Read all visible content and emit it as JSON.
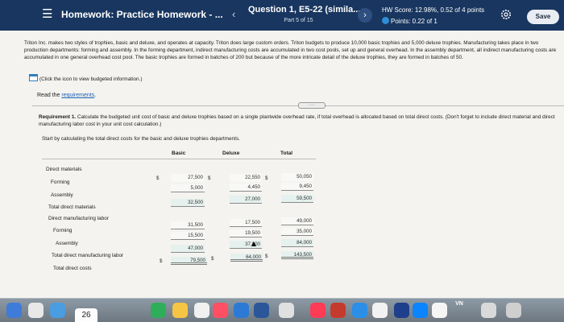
{
  "header": {
    "menu_icon": "hamburger-icon",
    "title": "Homework: Practice Homework - ...",
    "prev_icon": "chevron-left-icon",
    "question_title": "Question 1, E5-22 (simila...",
    "question_part": "Part 5 of 15",
    "next_icon": "chevron-right-icon",
    "hw_score": "HW Score: 12.98%, 0.52 of 4 points",
    "points": "Points: 0.22 of 1",
    "settings_icon": "gear-icon",
    "save_label": "Save"
  },
  "intro": "Triton Inc. makes two styles of trophies, basic and deluxe, and operates at capacity. Triton does large custom orders. Triton budgets to produce 10,000 basic trophies and 5,000 deluxe trophies. Manufacturing takes place in two production departments: forming and assembly. In the forming department, indirect manufacturing costs are accumulated in two cost pools, set up and general overhead. In the assembly department, all indirect manufacturing costs are accumulated in one general overhead cost pool. The basic trophies are formed in batches of 200 but because of the more intricate detail of the deluxe trophies, they are formed in batches of 50.",
  "budget_link": "(Click the icon to view budgeted information.)",
  "read_prefix": "Read the ",
  "read_link": "requirements",
  "read_suffix": ".",
  "divider_handle": "·····",
  "requirement_bold": "Requirement 1.",
  "requirement_text": " Calculate the budgeted unit cost of basic and deluxe trophies based on a single plantwide overhead rate, if total overhead is allocated based on total direct costs. (Don't forget to include direct material and direct manufacturing labor cost in your unit cost calculation.)",
  "start_text": "Start by calculating the total direct costs for the basic and deluxe trophies departments.",
  "table": {
    "headers": {
      "basic": "Basic",
      "deluxe": "Deluxe",
      "total": "Total"
    },
    "row_labels": {
      "dm": "Direct materials",
      "dm_forming": "Forming",
      "dm_assembly": "Assembly",
      "dm_total": "Total direct materials",
      "dl": "Direct manufacturing labor",
      "dl_forming": "Forming",
      "dl_assembly": "Assembly",
      "dl_total": "Total direct manufacturing labor",
      "total_direct": "Total direct costs"
    },
    "currency": "$",
    "dm_forming": {
      "basic": "27,500",
      "deluxe": "22,550",
      "total": "50,050"
    },
    "dm_assembly": {
      "basic": "5,000",
      "deluxe": "4,450",
      "total": "9,450"
    },
    "dm_total": {
      "basic": "32,500",
      "deluxe": "27,000",
      "total": "59,500"
    },
    "dl_forming": {
      "basic": "31,500",
      "deluxe": "17,500",
      "total": "49,000"
    },
    "dl_assembly": {
      "basic": "15,500",
      "deluxe": "19,500",
      "total": "35,000"
    },
    "dl_total": {
      "basic": "47,000",
      "deluxe": "37,000",
      "total": "84,000"
    },
    "total_direct": {
      "basic": "79,500",
      "deluxe": "64,000",
      "total": "143,500"
    }
  },
  "dock": {
    "calendar_day": "26",
    "language": "VN",
    "colors": {
      "header_bg": "#18365f",
      "link": "#1b61b5",
      "cell_highlight": "#e5f1ee"
    }
  }
}
